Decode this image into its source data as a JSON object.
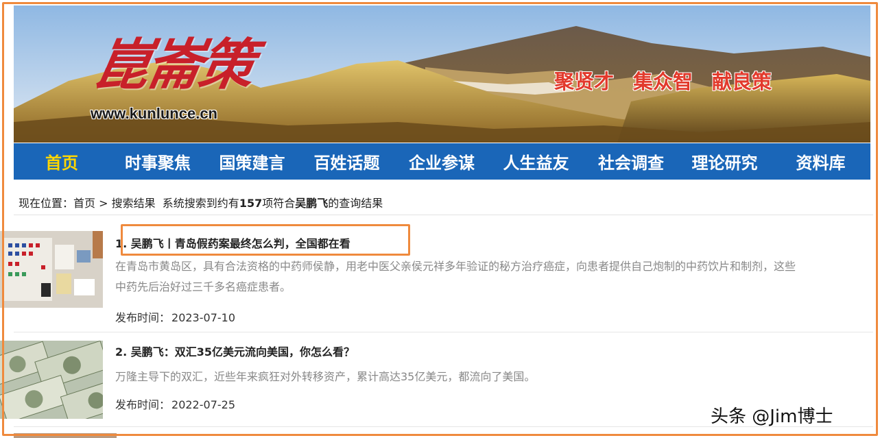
{
  "banner": {
    "logo_text": "崑崙策",
    "url": "www.kunlunce.cn",
    "slogans": [
      "聚贤才",
      "集众智",
      "献良策"
    ]
  },
  "nav": {
    "items": [
      {
        "label": "首页",
        "active": true
      },
      {
        "label": "时事聚焦"
      },
      {
        "label": "国策建言"
      },
      {
        "label": "百姓话题"
      },
      {
        "label": "企业参谋"
      },
      {
        "label": "人生益友"
      },
      {
        "label": "社会调查"
      },
      {
        "label": "理论研究"
      },
      {
        "label": "资料库"
      }
    ]
  },
  "breadcrumb": {
    "prefix": "现在位置：",
    "home": "首页",
    "separator": " > ",
    "current": "搜索结果",
    "summary_pre": "系统搜索到约有",
    "count": "157",
    "summary_mid": "项符合",
    "keyword": "吴鹏飞",
    "summary_post": "的查询结果"
  },
  "results": [
    {
      "title": "1. 吴鹏飞丨青岛假药案最终怎么判，全国都在看",
      "desc_line1": "在青岛市黄岛区，具有合法资格的中药师侯静，用老中医父亲侯元祥多年验证的秘方治疗癌症，向患者提供自己炮制的中药饮片和制剂，这些",
      "desc_line2": "中药先后治好过三千多名癌症患者。",
      "date_label": "发布时间：",
      "date": "2023-07-10"
    },
    {
      "title": "2. 吴鹏飞：双汇35亿美元流向美国，你怎么看？",
      "desc_line1": "万隆主导下的双汇，近些年来疯狂对外转移资产，累计高达35亿美元，都流向了美国。",
      "date_label": "发布时间：",
      "date": "2022-07-25"
    }
  ],
  "watermark": "头条 @Jim博士",
  "colors": {
    "nav_bg": "#1a66b8",
    "nav_active": "#ffd600",
    "highlight": "#ef8a3d",
    "slogan": "#e23a2c",
    "logo": "#c8202a"
  }
}
